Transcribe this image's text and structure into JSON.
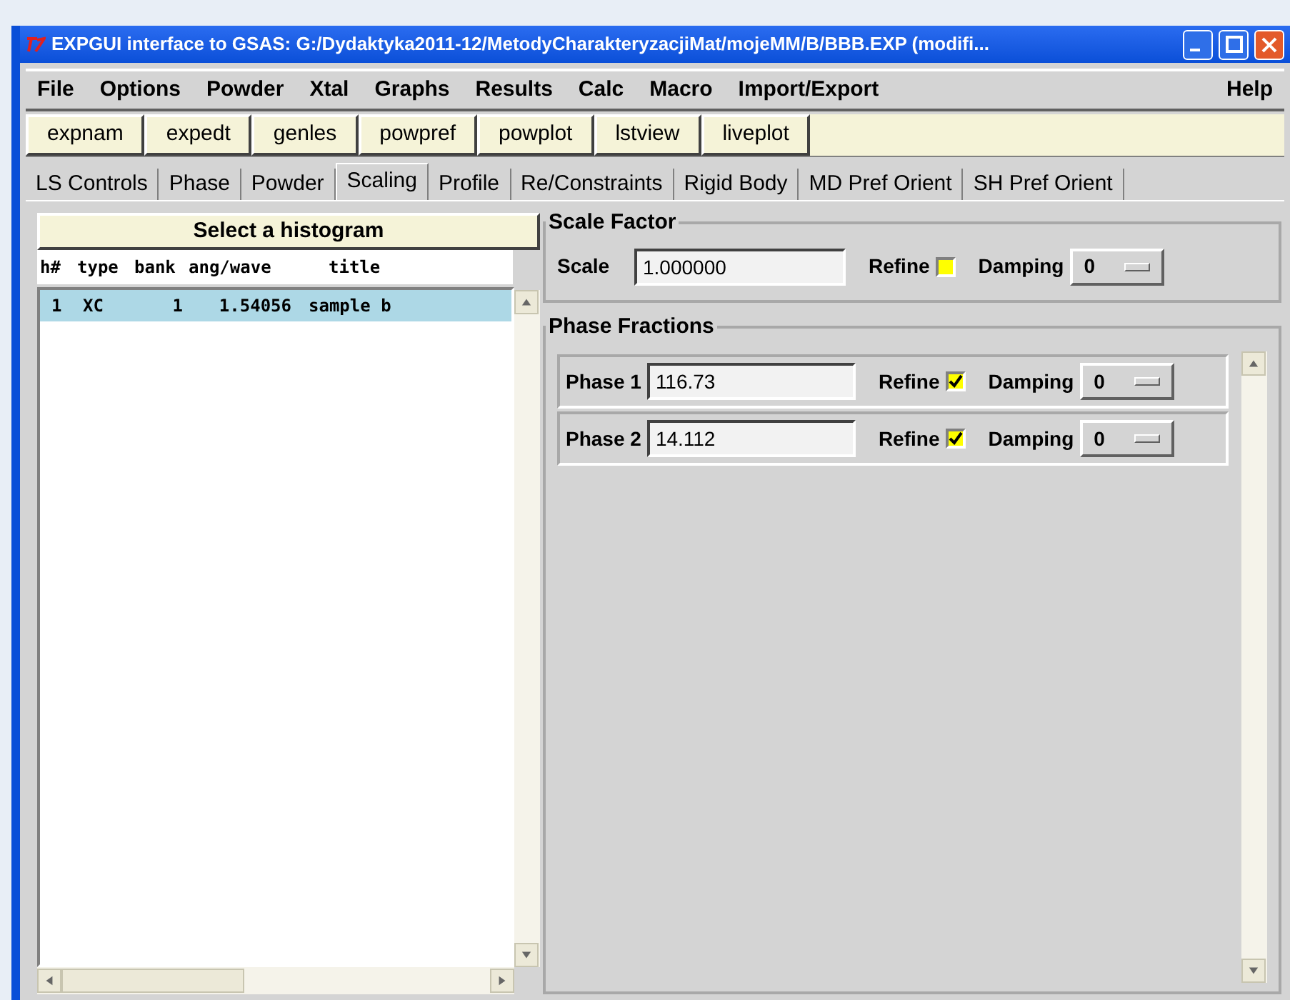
{
  "window": {
    "title": "EXPGUI interface to GSAS: G:/Dydaktyka2011-12/MetodyCharakteryzacjiMat/mojeMM/B/BBB.EXP (modifi..."
  },
  "menu": [
    {
      "label": "File"
    },
    {
      "label": "Options"
    },
    {
      "label": "Powder"
    },
    {
      "label": "Xtal"
    },
    {
      "label": "Graphs"
    },
    {
      "label": "Results"
    },
    {
      "label": "Calc"
    },
    {
      "label": "Macro"
    },
    {
      "label": "Import/Export"
    }
  ],
  "help_menu": "Help",
  "toolbar": [
    "expnam",
    "expedt",
    "genles",
    "powpref",
    "powplot",
    "lstview",
    "liveplot"
  ],
  "tabs": [
    {
      "label": "LS Controls",
      "selected": false
    },
    {
      "label": "Phase",
      "selected": false
    },
    {
      "label": "Powder",
      "selected": false
    },
    {
      "label": "Scaling",
      "selected": true
    },
    {
      "label": "Profile",
      "selected": false
    },
    {
      "label": "Re/Constraints",
      "selected": false
    },
    {
      "label": "Rigid Body",
      "selected": false
    },
    {
      "label": "MD Pref Orient",
      "selected": false
    },
    {
      "label": "SH Pref Orient",
      "selected": false
    }
  ],
  "histogram_panel": {
    "button": "Select a histogram",
    "columns": [
      "h#",
      "type",
      "bank",
      "ang/wave",
      "title"
    ],
    "rows": [
      {
        "cells": [
          "1",
          "XC",
          "1",
          "1.54056",
          "sample b"
        ],
        "selected": true
      }
    ]
  },
  "scale_factor": {
    "legend": "Scale Factor",
    "label": "Scale",
    "value": "1.000000",
    "refine_label": "Refine",
    "refine": false,
    "damping_label": "Damping",
    "damping": "0"
  },
  "phase_fractions": {
    "legend": "Phase Fractions",
    "phases": [
      {
        "label": "Phase 1",
        "value": "116.73",
        "refine_label": "Refine",
        "refine": true,
        "damping_label": "Damping",
        "damping": "0"
      },
      {
        "label": "Phase 2",
        "value": "14.112",
        "refine_label": "Refine",
        "refine": true,
        "damping_label": "Damping",
        "damping": "0"
      }
    ]
  }
}
